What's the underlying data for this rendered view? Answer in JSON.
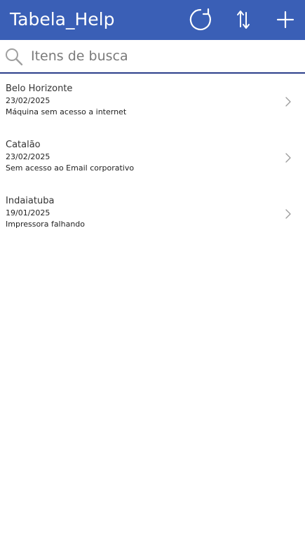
{
  "header": {
    "title": "Tabela_Help",
    "icons": {
      "refresh": "refresh-icon",
      "sort": "sort-icon",
      "add": "add-icon"
    },
    "background": "#3a5fb6"
  },
  "search": {
    "placeholder": "Itens de busca",
    "value": "",
    "icon": "search-icon",
    "underline_color": "#2b3e8a"
  },
  "items": [
    {
      "title": "Belo Horizonte",
      "date": "23/02/2025",
      "description": "Máquina sem acesso a internet"
    },
    {
      "title": "Catalão",
      "date": "23/02/2025",
      "description": "Sem acesso ao Email corporativo"
    },
    {
      "title": "Indaiatuba",
      "date": "19/01/2025",
      "description": "Impressora falhando"
    }
  ]
}
